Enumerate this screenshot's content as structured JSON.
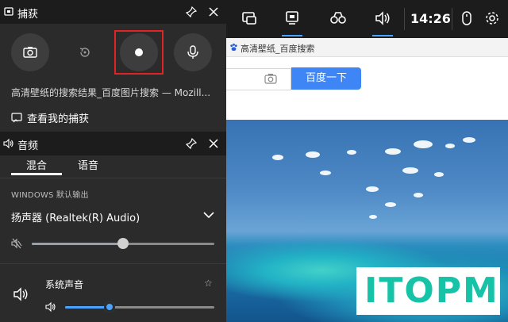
{
  "browser": {
    "tab_title": "高清壁纸_百度搜索",
    "search_button": "百度一下"
  },
  "topbar": {
    "clock": "14:26",
    "icons": [
      "widget-menu-icon",
      "capture-icon",
      "performance-icon",
      "audio-icon",
      "mouse-icon",
      "settings-icon"
    ],
    "accent": "#4aa3ff"
  },
  "capture_panel": {
    "title": "捕获",
    "icons": [
      "screenshot-icon",
      "record-last-icon",
      "record-icon",
      "microphone-icon"
    ],
    "window_title": "高清壁纸的搜索结果_百度图片搜索 — Mozill...",
    "see_captures": "查看我的捕获",
    "highlight_color": "#e02424"
  },
  "audio_panel": {
    "title": "音频",
    "tabs": [
      {
        "label": "混合"
      },
      {
        "label": "语音"
      }
    ],
    "section_label": "WINDOWS 默认输出",
    "device": "扬声器 (Realtek(R) Audio)",
    "master_volume": 0.5,
    "app": {
      "name": "系统声音",
      "volume": 0.3
    }
  },
  "watermark": {
    "text": "ITOPM"
  }
}
